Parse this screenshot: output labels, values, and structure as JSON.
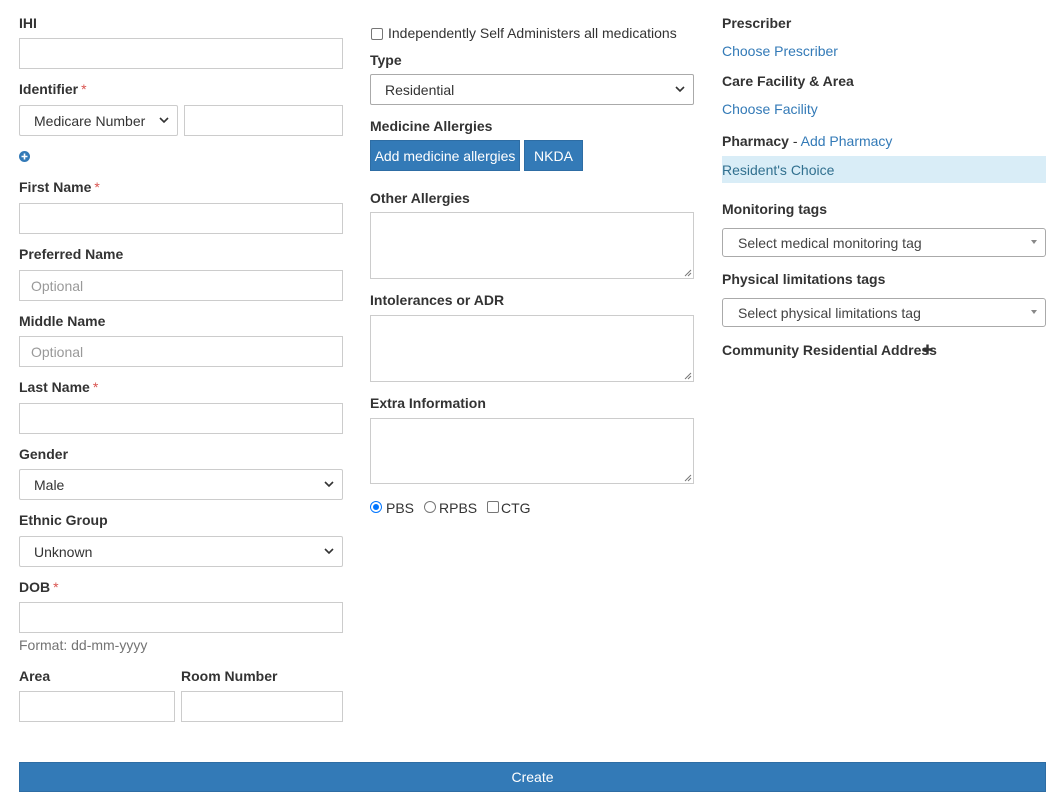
{
  "left": {
    "ihi_label": "IHI",
    "identifier_label": "Identifier",
    "identifier_type": "Medicare Number",
    "first_name_label": "First Name",
    "preferred_name_label": "Preferred Name",
    "preferred_name_placeholder": "Optional",
    "middle_name_label": "Middle Name",
    "middle_name_placeholder": "Optional",
    "last_name_label": "Last Name",
    "gender_label": "Gender",
    "gender_value": "Male",
    "ethnic_group_label": "Ethnic Group",
    "ethnic_group_value": "Unknown",
    "dob_label": "DOB",
    "dob_hint": "Format: dd-mm-yyyy",
    "area_label": "Area",
    "room_number_label": "Room Number",
    "required_mark": "*"
  },
  "middle": {
    "self_admin_label": "Independently Self Administers all medications",
    "type_label": "Type",
    "type_value": "Residential",
    "medicine_allergies_label": "Medicine Allergies",
    "add_allergies_button": "Add medicine allergies",
    "nkda_button": "NKDA",
    "other_allergies_label": "Other Allergies",
    "intolerances_label": "Intolerances or ADR",
    "extra_info_label": "Extra Information",
    "pbs_label": "PBS",
    "rpbs_label": "RPBS",
    "ctg_label": "CTG"
  },
  "right": {
    "prescriber_label": "Prescriber",
    "choose_prescriber": "Choose Prescriber",
    "care_facility_label": "Care Facility & Area",
    "choose_facility": "Choose Facility",
    "pharmacy_label": "Pharmacy",
    "pharmacy_sep": " - ",
    "add_pharmacy": "Add Pharmacy",
    "pharmacy_value": "Resident's Choice",
    "monitoring_tags_label": "Monitoring tags",
    "monitoring_placeholder": "Select medical monitoring tag",
    "physical_tags_label": "Physical limitations tags",
    "physical_placeholder": "Select physical limitations tag",
    "community_address_label": "Community Residential Address"
  },
  "footer": {
    "create_button": "Create"
  },
  "colors": {
    "primary": "#337ab7",
    "required": "#d9534f",
    "highlight": "#d9edf7"
  }
}
